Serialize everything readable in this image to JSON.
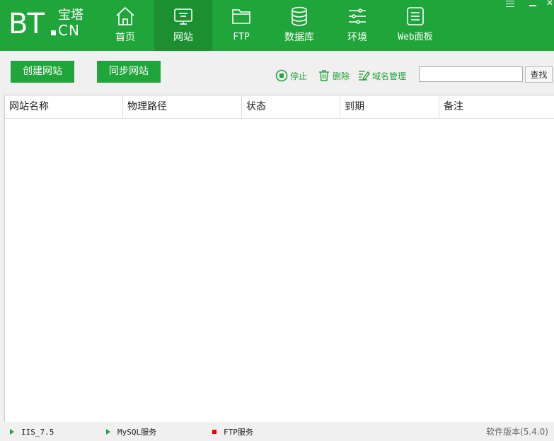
{
  "logo": {
    "bt": "BT",
    "cn_top": "宝塔",
    "cn_bottom": "CN"
  },
  "nav": [
    {
      "label": "首页",
      "icon": "home-icon"
    },
    {
      "label": "网站",
      "icon": "monitor-icon",
      "active": true
    },
    {
      "label": "FTP",
      "icon": "folder-icon"
    },
    {
      "label": "数据库",
      "icon": "database-icon"
    },
    {
      "label": "环境",
      "icon": "sliders-icon"
    },
    {
      "label": "Web面板",
      "icon": "panel-icon"
    }
  ],
  "toolbar": {
    "create_label": "创建网站",
    "sync_label": "同步网站",
    "stop_label": "停止",
    "delete_label": "删除",
    "domain_label": "域名管理",
    "search_value": "",
    "search_button": "查找"
  },
  "table": {
    "columns": [
      "网站名称",
      "物理路径",
      "状态",
      "到期",
      "备注"
    ],
    "rows": []
  },
  "statusbar": {
    "services": [
      {
        "label": "IIS_7.5",
        "state": "running"
      },
      {
        "label": "MySQL服务",
        "state": "running"
      },
      {
        "label": "FTP服务",
        "state": "stopped"
      }
    ],
    "version": "软件版本(5.4.0)"
  },
  "colors": {
    "brand": "#20a53a",
    "brand_active": "#1c8f31",
    "stopped": "#ee0000"
  }
}
